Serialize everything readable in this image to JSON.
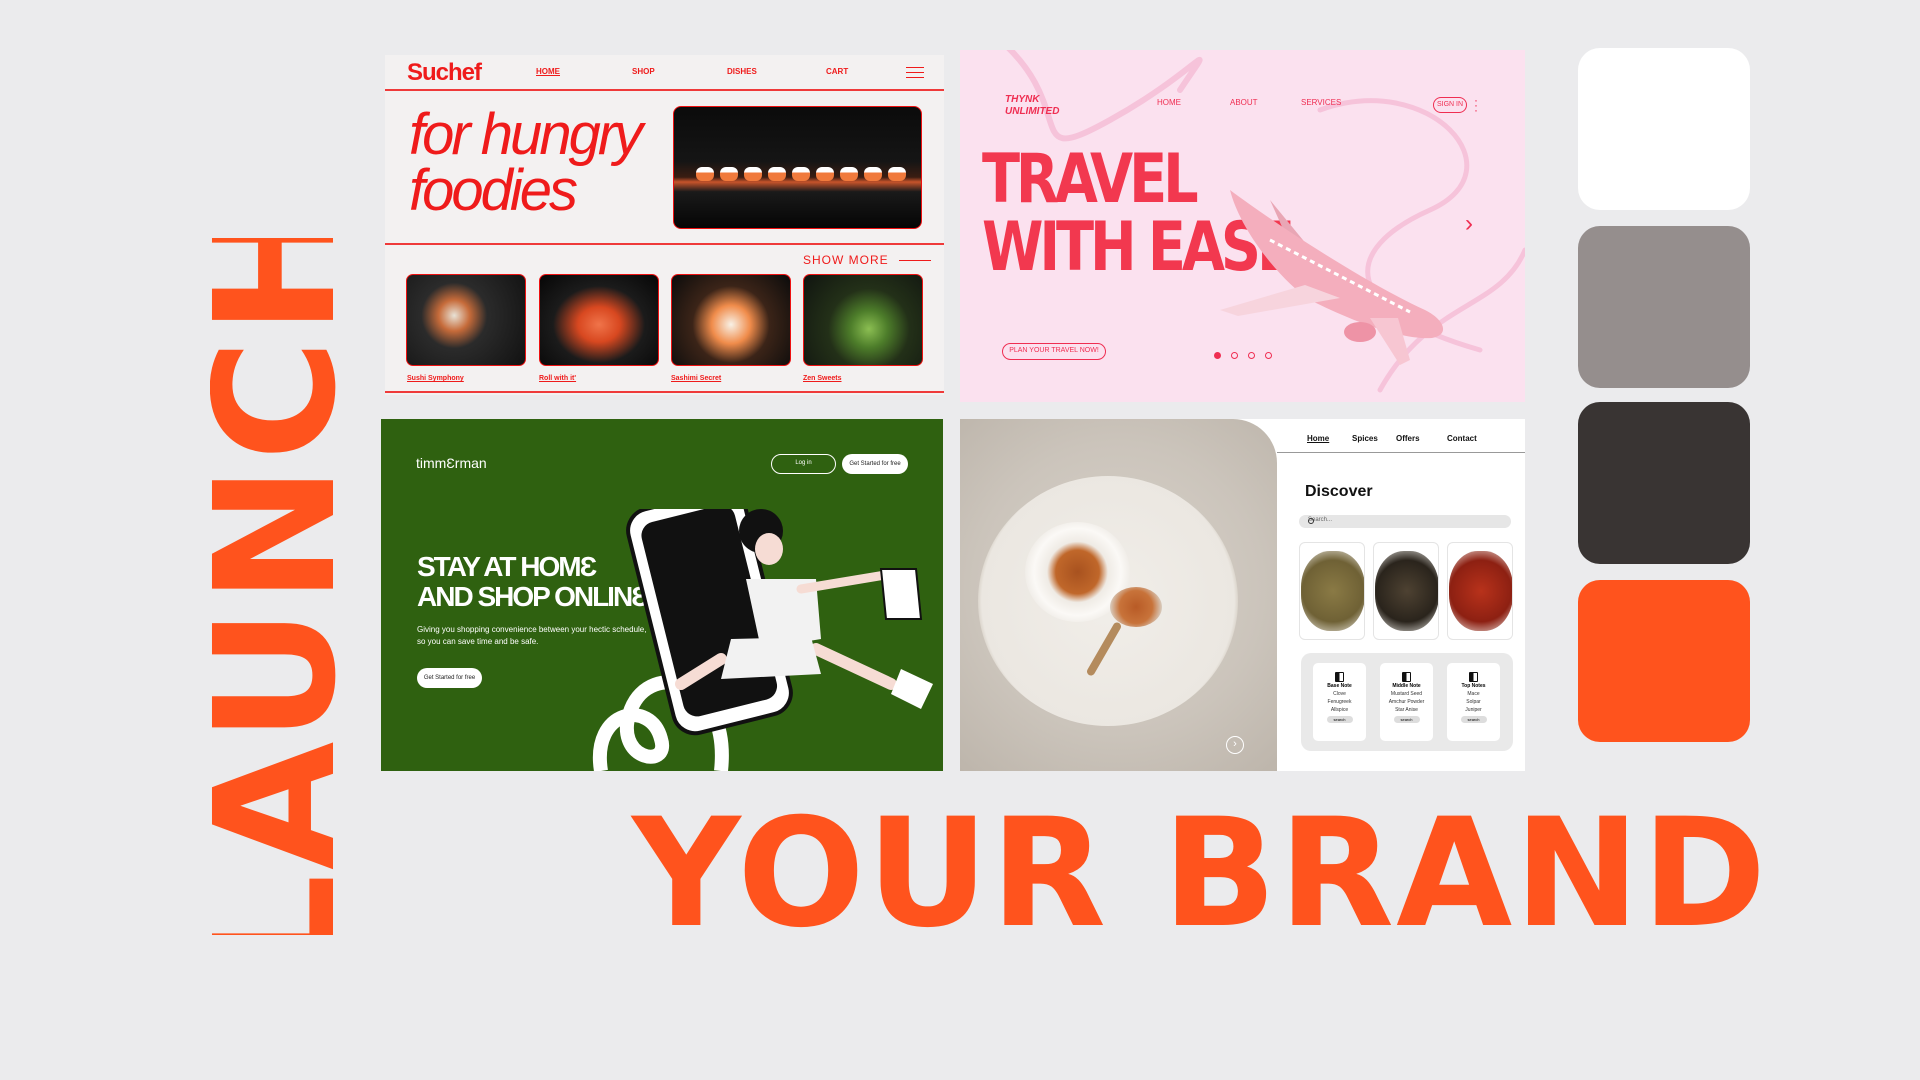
{
  "poster": {
    "launch": "LAUNCH",
    "your_brand": "YOUR BRAND",
    "accent_color": "#ff531d"
  },
  "swatches": [
    "#ffffff",
    "#958e8d",
    "#393433",
    "#ff531d"
  ],
  "suchef": {
    "logo": "Suchef",
    "nav": [
      "HOME",
      "SHOP",
      "DISHES",
      "CART"
    ],
    "menu_icon": "hamburger-icon",
    "headline_line1": "for hungry",
    "headline_line2": "foodies",
    "show_more": "SHOW MORE",
    "dishes": [
      "Sushi Symphony",
      "Roll with it'",
      "Sashimi Secret",
      "Zen Sweets"
    ],
    "accent": "#ef1b1b"
  },
  "travel": {
    "brand_line1": "THYNK",
    "brand_line2": "UNLIMITED",
    "nav": [
      "HOME",
      "ABOUT",
      "SERVICES"
    ],
    "sign_in": "SIGN IN",
    "title_line1": "TRAVEL",
    "title_line2": "WITH EASE",
    "plan_button": "PLAN YOUR TRAVEL NOW!",
    "next_icon": "chevron-right-icon",
    "slide_active": 1,
    "slide_count": 4,
    "accent": "#f2384f"
  },
  "timmerman": {
    "logo": "timmƐrman",
    "login": "Log in",
    "get_started": "Get Started for free",
    "title_line1": "STAY AT HOMƐ",
    "title_line2": "AND SHOP ONLINƐ",
    "subtitle_line1": "Giving you shopping convenience between your hectic schedule,",
    "subtitle_line2": "so you can save time and be safe.",
    "cta": "Get Started for free",
    "background": "#2f6110"
  },
  "spices": {
    "nav": [
      "Home",
      "Spices",
      "Offers",
      "Contact"
    ],
    "discover": "Discover",
    "search_placeholder": "Search...",
    "search_icon": "search-icon",
    "notes": [
      {
        "title": "Base Note",
        "items": [
          "Clove",
          "Fenugreek",
          "Allspice"
        ],
        "button": "search"
      },
      {
        "title": "Middle Note",
        "items": [
          "Mustard Seed",
          "Amchur Powder",
          "Star Anise"
        ],
        "button": "search"
      },
      {
        "title": "Top Notes",
        "items": [
          "Mace",
          "Solpar",
          "Juniper"
        ],
        "button": "search"
      }
    ]
  }
}
